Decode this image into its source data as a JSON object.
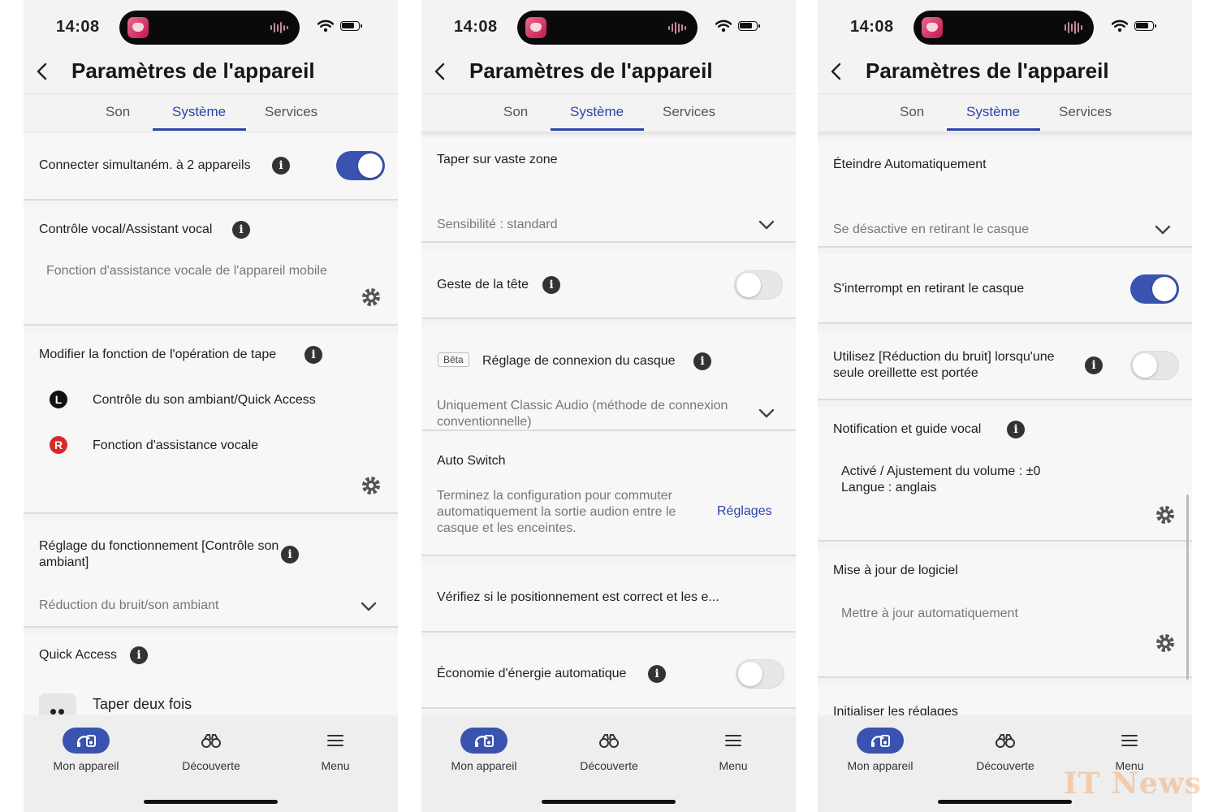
{
  "status": {
    "time": "14:08"
  },
  "header": {
    "title": "Paramètres de l'appareil"
  },
  "tabs": [
    "Son",
    "Système",
    "Services"
  ],
  "bottom_nav": [
    "Mon appareil",
    "Découverte",
    "Menu"
  ],
  "colors": {
    "accent": "#2a45a8",
    "toggle_on": "#3a53b0",
    "badge_right": "#d62a2a"
  },
  "screen1": {
    "dual": "Connecter simultaném. à 2 appareils",
    "voice_title": "Contrôle vocal/Assistant vocal",
    "voice_desc": "Fonction d'assistance vocale de l'appareil mobile",
    "tap_title": "Modifier la fonction de l'opération de tape",
    "left_badge": "L",
    "left_func": "Contrôle du son ambiant/Quick Access",
    "right_badge": "R",
    "right_func": "Fonction d'assistance vocale",
    "ambient_title": "Réglage du fonctionnement [Contrôle son ambiant]",
    "ambient_value": "Réduction du bruit/son ambiant",
    "quick_title": "Quick Access",
    "quick_item": "Taper deux fois"
  },
  "screen2": {
    "tap_zone": "Taper sur vaste zone",
    "sensitivity": "Sensibilité : standard",
    "head_gesture": "Geste de la tête",
    "beta": "Bêta",
    "connection_title": "Réglage de connexion du casque",
    "connection_value": "Uniquement Classic Audio (méthode de connexion conventionnelle)",
    "auto_switch": "Auto Switch",
    "auto_switch_desc": "Terminez la configuration pour commuter automatiquement la sortie audion entre le casque et les enceintes.",
    "settings_link": "Réglages",
    "verify": "Vérifiez si le positionnement est correct et les e...",
    "energy": "Économie d'énergie automatique"
  },
  "screen3": {
    "auto_off": "Éteindre Automatiquement",
    "auto_off_value": "Se désactive en retirant le casque",
    "pause": "S'interrompt en retirant le casque",
    "nc_single": "Utilisez [Réduction du bruit] lorsqu'une seule oreillette est portée",
    "notif_title": "Notification et guide vocal",
    "notif_line1": "Activé / Ajustement du volume : ±0",
    "notif_line2": "Langue : anglais",
    "update_title": "Mise à jour de logiciel",
    "update_desc": "Mettre à jour automatiquement",
    "reset": "Initialiser les réglages"
  },
  "watermark": "IT News"
}
